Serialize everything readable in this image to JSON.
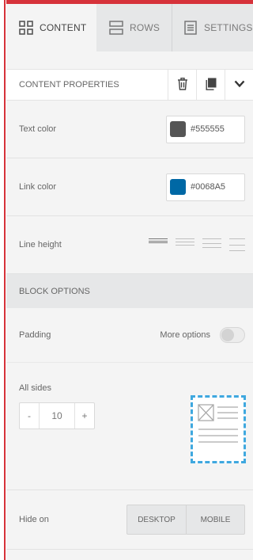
{
  "tabs": [
    {
      "label": "CONTENT",
      "icon": "grid-icon",
      "active": true
    },
    {
      "label": "ROWS",
      "icon": "rows-icon",
      "active": false
    },
    {
      "label": "SETTINGS",
      "icon": "settings-doc-icon",
      "active": false
    }
  ],
  "content_properties": {
    "title": "CONTENT PROPERTIES",
    "actions": [
      "trash-icon",
      "copy-icon",
      "chevron-down-icon"
    ]
  },
  "text_color": {
    "label": "Text color",
    "value": "#555555",
    "swatch": "#555555"
  },
  "link_color": {
    "label": "Link color",
    "value": "#0068A5",
    "swatch": "#0068a5"
  },
  "line_height": {
    "label": "Line height",
    "selected_index": 0
  },
  "block_options": {
    "title": "BLOCK OPTIONS",
    "padding_label": "Padding",
    "more_options_label": "More options",
    "more_options_enabled": false,
    "all_sides_label": "All sides",
    "padding_value": "10",
    "decrement": "-",
    "increment": "+"
  },
  "hide_on": {
    "label": "Hide on",
    "options": [
      "DESKTOP",
      "MOBILE"
    ]
  },
  "colors": {
    "accent": "#3fa8df",
    "frame": "#d6323a"
  }
}
